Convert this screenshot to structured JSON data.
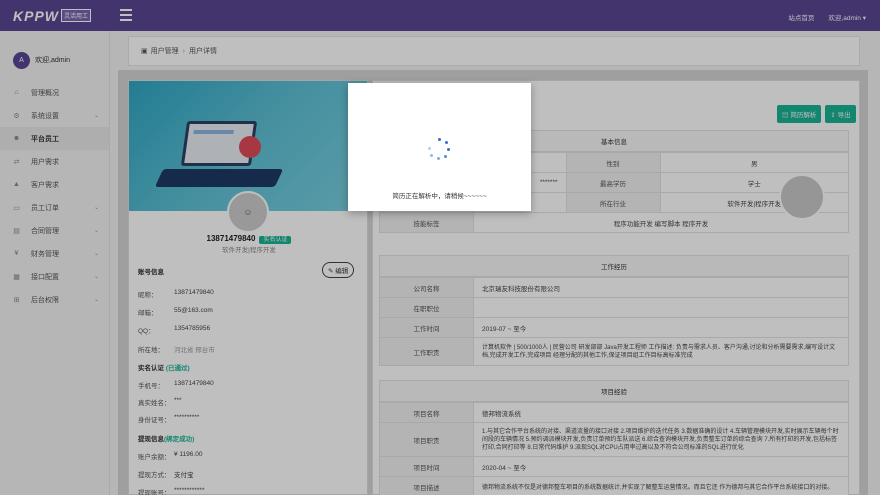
{
  "app": {
    "logo": "KPPW",
    "logo_sub": "灵活用工"
  },
  "topbar": {
    "home_link": "站点首页",
    "welcome": "欢迎,admin"
  },
  "sidebar": {
    "user_initial": "A",
    "user_name": "欢迎,admin",
    "items": [
      {
        "label": "管理概况",
        "icon": "home-icon"
      },
      {
        "label": "系统设置",
        "icon": "gear-icon"
      },
      {
        "label": "平台员工",
        "icon": "users-icon"
      },
      {
        "label": "用户需求",
        "icon": "exchange-icon"
      },
      {
        "label": "客户需求",
        "icon": "graduation-icon"
      },
      {
        "label": "员工订单",
        "icon": "truck-icon"
      },
      {
        "label": "合同管理",
        "icon": "file-icon"
      },
      {
        "label": "财务管理",
        "icon": "money-icon"
      },
      {
        "label": "接口配置",
        "icon": "briefcase-icon"
      },
      {
        "label": "后台权限",
        "icon": "sitemap-icon"
      }
    ]
  },
  "breadcrumb": {
    "first": "用户管理",
    "second": "用户详情"
  },
  "profile": {
    "phone": "13871479840",
    "verified_badge": "实名认证",
    "role": "软件开发|程序开发",
    "edit_label": "编辑",
    "account_title": "账号信息",
    "account": [
      {
        "k": "昵称：",
        "v": "13871479840"
      },
      {
        "k": "邮箱：",
        "v": "55@163.com"
      },
      {
        "k": "QQ：",
        "v": "1354785956"
      },
      {
        "k": "所在地：",
        "v": "河北省   邢台市"
      }
    ],
    "realname_title": "实名认证",
    "realname_status": "(已通过)",
    "realname": [
      {
        "k": "手机号：",
        "v": "13871479840"
      },
      {
        "k": "真实姓名：",
        "v": "***"
      },
      {
        "k": "身份证号：",
        "v": "**********"
      }
    ],
    "withdraw_title": "提现信息",
    "withdraw_status": "(绑定成功)",
    "withdraw": [
      {
        "k": "账户余额：",
        "v": "¥ 1196.00"
      },
      {
        "k": "提现方式：",
        "v": "支付宝"
      },
      {
        "k": "提现账号：",
        "v": "************"
      }
    ]
  },
  "buttons": {
    "parse": "简历解析",
    "export": "导出"
  },
  "basic": {
    "title": "基本信息",
    "gender_label": "性别",
    "gender": "男",
    "edu_label": "最高学历",
    "edu": "学士",
    "partial_value": "*******",
    "industry_label": "所在行业",
    "industry": "软件开发|程序开发",
    "skills_label": "技能标签",
    "skills": "程序功能开发  编写脚本  程序开发"
  },
  "work": {
    "title": "工作经历",
    "company_label": "公司名称",
    "company": "北京瑞友科技股份有限公司",
    "position_label": "在职职位",
    "position": "",
    "time_label": "工作时间",
    "time": "2019-07 ~ 至今",
    "duty_label": "工作职责",
    "duty": "计算机软件 | 500/1000人 | 民营公司 研发部部 Java开发工程师 工作描述: 负责与需求人员、客户沟通,讨论和分析需要需求,编写设计文档,完成开发工作,完成项目 经理分配的其他工作,保证项目组工作目标高标准完成"
  },
  "project": {
    "title": "项目经验",
    "name_label": "项目名称",
    "name": "德邦物流系统",
    "duty_label": "项目职责",
    "duty": "1.与其它合作平台系统的对接、渠道流量的接口对接 2.项目维护的迭代任务 3.数据准确的设计 4.车辆管理模块开发,实时展示车辆每个时间段的车辆情况 5.预约调派模块开发,负责订单预约车队派送 6.综合查询模块开发,负责整车订单的综合查询 7.所有打印的开发,包括标签打印,合同打印等 8.日常代码维护 9.派现SQL对CPU占用率过高以及不符合公司标准的SQL进行优化",
    "time_label": "项目时间",
    "time": "2020-04 ~ 至今",
    "desc_label": "项目描述",
    "desc": "德邦物流系统不仅是对德邦整车项目的系统数据统计,并实现了解整车运营情况。而且它还 作为德邦与其它合作平台系统接口的对接。"
  },
  "modal": {
    "message": "简历正在解析中，请稍候~~~~~~"
  }
}
